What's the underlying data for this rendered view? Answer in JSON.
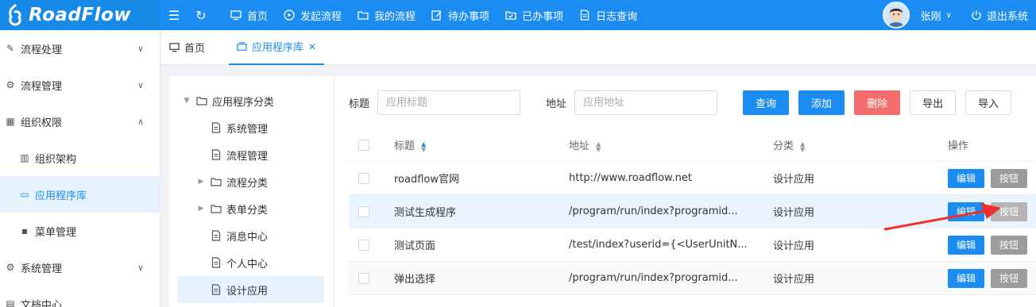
{
  "app": {
    "logo_text": "RoadFlow"
  },
  "topnav": {
    "items": [
      {
        "label": "首页",
        "icon": "monitor-icon"
      },
      {
        "label": "发起流程",
        "icon": "play-circle-icon"
      },
      {
        "label": "我的流程",
        "icon": "folder-icon"
      },
      {
        "label": "待办事项",
        "icon": "edit-icon"
      },
      {
        "label": "已办事项",
        "icon": "check-folder-icon"
      },
      {
        "label": "日志查询",
        "icon": "document-icon"
      }
    ],
    "user_name": "张刚",
    "logout": "退出系统"
  },
  "sidebar": {
    "items": [
      {
        "label": "流程处理",
        "icon": "edit-icon",
        "expanded": false
      },
      {
        "label": "流程管理",
        "icon": "file-settings-icon",
        "expanded": false
      },
      {
        "label": "组织权限",
        "icon": "org-icon",
        "expanded": true
      },
      {
        "label": "组织架构",
        "icon": "org-chart-icon",
        "sub": true
      },
      {
        "label": "应用程序库",
        "icon": "app-library-icon",
        "sub": true,
        "active": true
      },
      {
        "label": "菜单管理",
        "icon": "grid-icon",
        "sub": true
      },
      {
        "label": "系统管理",
        "icon": "gear-icon",
        "expanded": false
      },
      {
        "label": "文档中心",
        "icon": "document-icon",
        "expanded": false
      }
    ]
  },
  "tabs": [
    {
      "label": "首页"
    },
    {
      "label": "应用程序库",
      "active": true
    }
  ],
  "tree": {
    "root": "应用程序分类",
    "nodes": [
      {
        "label": "系统管理",
        "type": "file"
      },
      {
        "label": "流程管理",
        "type": "file"
      },
      {
        "label": "流程分类",
        "type": "folder"
      },
      {
        "label": "表单分类",
        "type": "folder"
      },
      {
        "label": "消息中心",
        "type": "file"
      },
      {
        "label": "个人中心",
        "type": "file"
      },
      {
        "label": "设计应用",
        "type": "file",
        "selected": true
      }
    ]
  },
  "search": {
    "title_label": "标题",
    "title_placeholder": "应用标题",
    "addr_label": "地址",
    "addr_placeholder": "应用地址",
    "query": "查询",
    "add": "添加",
    "delete": "删除",
    "export": "导出",
    "import": "导入"
  },
  "table": {
    "columns": {
      "title": "标题",
      "addr": "地址",
      "cat": "分类",
      "ops": "操作"
    },
    "rows": [
      {
        "title": "roadflow官网",
        "addr": "http://www.roadflow.net",
        "cat": "设计应用"
      },
      {
        "title": "测试生成程序",
        "addr": "/program/run/index?programid...",
        "cat": "设计应用"
      },
      {
        "title": "测试页面",
        "addr": "/test/index?userid={<UserUnitN...",
        "cat": "设计应用"
      },
      {
        "title": "弹出选择",
        "addr": "/program/run/index?programid...",
        "cat": "设计应用"
      }
    ],
    "edit_label": "编辑",
    "button_label": "按钮"
  },
  "colors": {
    "accent": "#1b8df2",
    "danger": "#f56c6c",
    "annotation": "#f0302b"
  }
}
